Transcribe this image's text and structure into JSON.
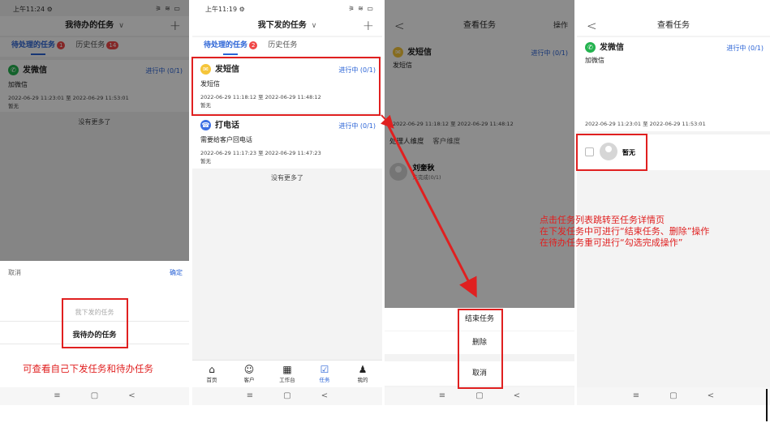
{
  "screen1": {
    "status": {
      "time": "上午11:24 ⚙",
      "icons": "⚞ ≋ ▭"
    },
    "header": {
      "title": "我待办的任务",
      "chevron": "∨",
      "plus": "+"
    },
    "tabs": {
      "pending": "待处理的任务",
      "pending_badge": "1",
      "history": "历史任务",
      "history_badge": "14"
    },
    "task": {
      "title": "发微信",
      "status": "进行中 (0/1)",
      "desc": "加微信",
      "time": "2022-06-29 11:23:01 至 2022-06-29 11:53:01",
      "note": "暂无"
    },
    "nomore": "没有更多了",
    "sheet": {
      "cancel": "取消",
      "confirm": "确定",
      "options": [
        "我下发的任务",
        "我待办的任务"
      ]
    },
    "caption": "可查看自己下发任务和待办任务"
  },
  "screen2": {
    "status": {
      "time": "上午11:19 ⚙",
      "icons": "⚞ ≋ ▭"
    },
    "header": {
      "title": "我下发的任务",
      "chevron": "∨",
      "plus": "+"
    },
    "tabs": {
      "pending": "待处理的任务",
      "pending_badge": "2",
      "history": "历史任务"
    },
    "tasks": [
      {
        "title": "发短信",
        "status": "进行中 (0/1)",
        "desc": "发短信",
        "time": "2022-06-29 11:18:12 至 2022-06-29 11:48:12",
        "note": "暂无"
      },
      {
        "title": "打电话",
        "status": "进行中 (0/1)",
        "desc": "需要给客户回电话",
        "time": "2022-06-29 11:17:23 至 2022-06-29 11:47:23",
        "note": "暂无"
      }
    ],
    "nomore": "没有更多了",
    "tabbar": [
      {
        "icon": "home-icon",
        "glyph": "⌂",
        "label": "首页"
      },
      {
        "icon": "customer-icon",
        "glyph": "☺",
        "label": "客户"
      },
      {
        "icon": "workbench-icon",
        "glyph": "▦",
        "label": "工作台"
      },
      {
        "icon": "task-icon",
        "glyph": "☑",
        "label": "任务"
      },
      {
        "icon": "profile-icon",
        "glyph": "♟",
        "label": "我的"
      }
    ]
  },
  "screen3": {
    "status": {
      "time": "上午11:19 ⚙",
      "icons": "⚞ ≋ ▭"
    },
    "header": {
      "back": "<",
      "title": "查看任务",
      "action": "操作"
    },
    "task": {
      "title": "发短信",
      "status": "进行中 (0/1)",
      "desc": "发短信",
      "time": "2022-06-29 11:18:12 至 2022-06-29 11:48:12"
    },
    "dims": {
      "handler": "处理人维度",
      "customer": "客户维度"
    },
    "person": {
      "name": "刘奎秋",
      "state": "未完成(0/1)"
    },
    "sheet": {
      "end": "结束任务",
      "delete": "删除",
      "cancel": "取消"
    }
  },
  "screen4": {
    "header": {
      "back": "<",
      "title": "查看任务"
    },
    "task": {
      "title": "发微信",
      "status": "进行中 (0/1)",
      "desc": "加微信",
      "time": "2022-06-29 11:23:01 至 2022-06-29 11:53:01"
    },
    "person": {
      "name": "暂无"
    }
  },
  "annotation": {
    "lines": [
      "点击任务列表跳转至任务详情页",
      "在下发任务中可进行“结束任务、删除”操作",
      "在待办任务重可进行“勾选完成操作”"
    ]
  },
  "navbar": {
    "menu": "≡",
    "home": "▢",
    "back": "<"
  },
  "colors": {
    "accent": "#2a63d6",
    "annotation": "#e02020",
    "wechat": "#24b34f"
  }
}
